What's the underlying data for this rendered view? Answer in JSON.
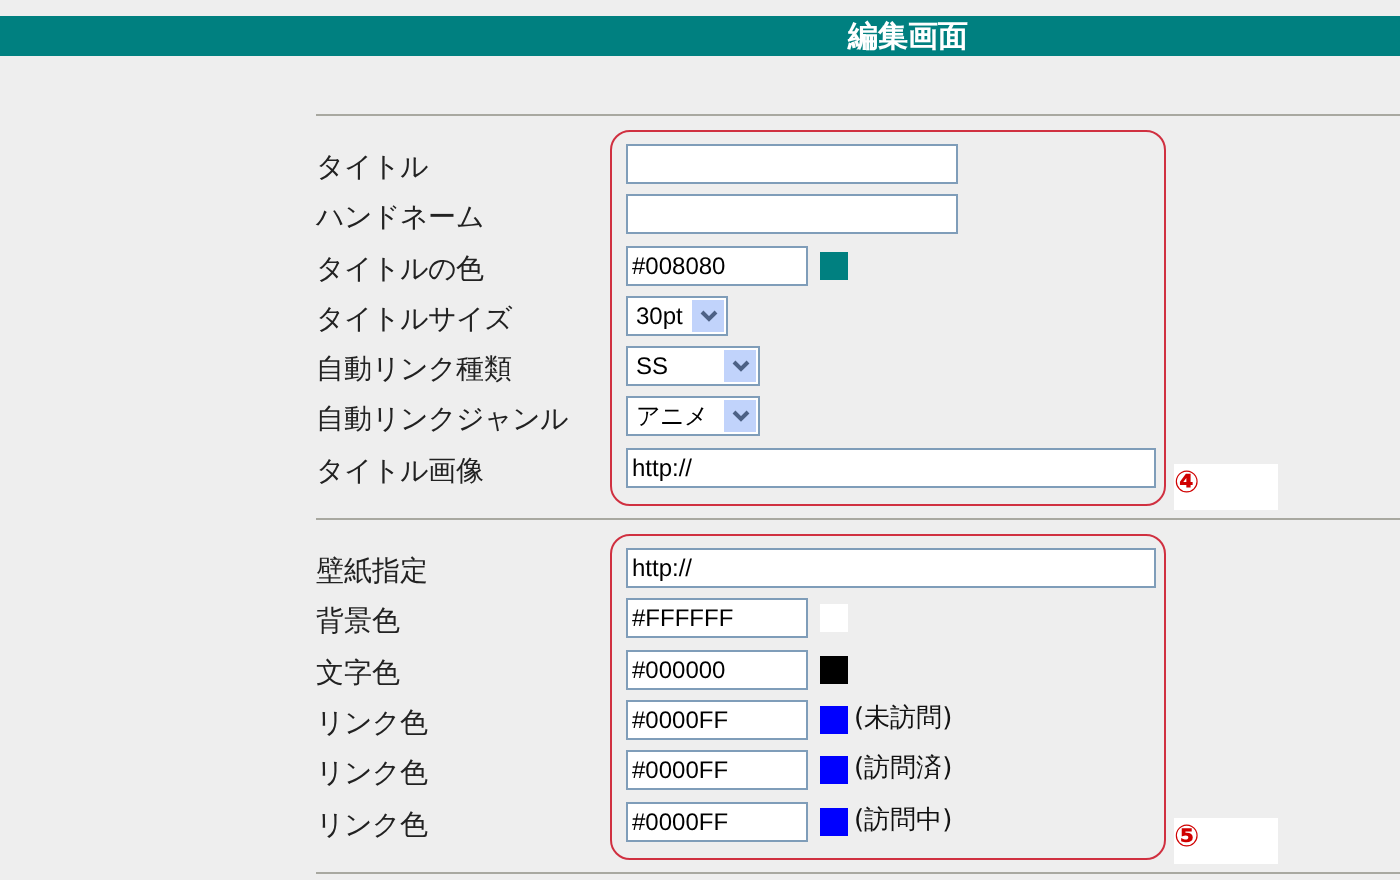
{
  "header": {
    "title": "編集画面"
  },
  "sections": [
    {
      "marker": "④",
      "rows": [
        {
          "kind": "text",
          "label": "タイトル",
          "value": ""
        },
        {
          "kind": "text",
          "label": "ハンドネーム",
          "value": ""
        },
        {
          "kind": "color",
          "label": "タイトルの色",
          "value": "#008080",
          "color": "#008080"
        },
        {
          "kind": "shortselect",
          "label": "タイトルサイズ",
          "value": "30pt"
        },
        {
          "kind": "select",
          "label": "自動リンク種類",
          "value": "SS"
        },
        {
          "kind": "select",
          "label": "自動リンクジャンル",
          "value": "アニメ"
        },
        {
          "kind": "url",
          "label": "タイトル画像",
          "value": "http://"
        }
      ]
    },
    {
      "marker": "⑤",
      "rows": [
        {
          "kind": "url",
          "label": "壁紙指定",
          "value": "http://"
        },
        {
          "kind": "color",
          "label": "背景色",
          "value": "#FFFFFF",
          "color": "#ffffff"
        },
        {
          "kind": "color",
          "label": "文字色",
          "value": "#000000",
          "color": "#000000"
        },
        {
          "kind": "color",
          "label": "リンク色",
          "value": "#0000FF",
          "color": "#0000ff",
          "note": "(未訪問)"
        },
        {
          "kind": "color",
          "label": "リンク色",
          "value": "#0000FF",
          "color": "#0000ff",
          "note": "(訪問済)"
        },
        {
          "kind": "color",
          "label": "リンク色",
          "value": "#0000FF",
          "color": "#0000ff",
          "note": "(訪問中)"
        }
      ]
    }
  ]
}
